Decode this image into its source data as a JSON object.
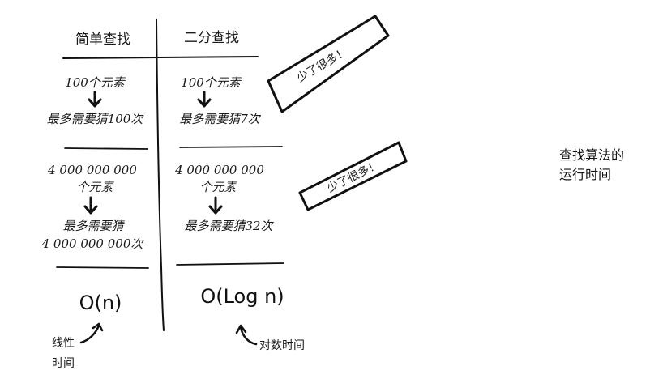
{
  "columns": {
    "simple": {
      "header": "简单查找",
      "row1": {
        "count": "100个元素",
        "guess": "最多需要猜100次"
      },
      "row2": {
        "count_num": "4 000 000 000",
        "count_unit": "个元素",
        "guess_line1": "最多需要猜",
        "guess_line2": "4 000 000 000次"
      },
      "bigO": "O(n)",
      "note_line1": "线性",
      "note_line2": "时间"
    },
    "binary": {
      "header": "二分查找",
      "row1": {
        "count": "100个元素",
        "guess": "最多需要猜7次"
      },
      "row2": {
        "count_num": "4 000 000 000",
        "count_unit": "个元素",
        "guess": "最多需要猜32次"
      },
      "bigO": "O(Log n)",
      "note": "对数时间"
    }
  },
  "callouts": [
    "少了很多！",
    "少了很多！"
  ],
  "caption": {
    "line1": "查找算法的",
    "line2": "运行时间"
  }
}
